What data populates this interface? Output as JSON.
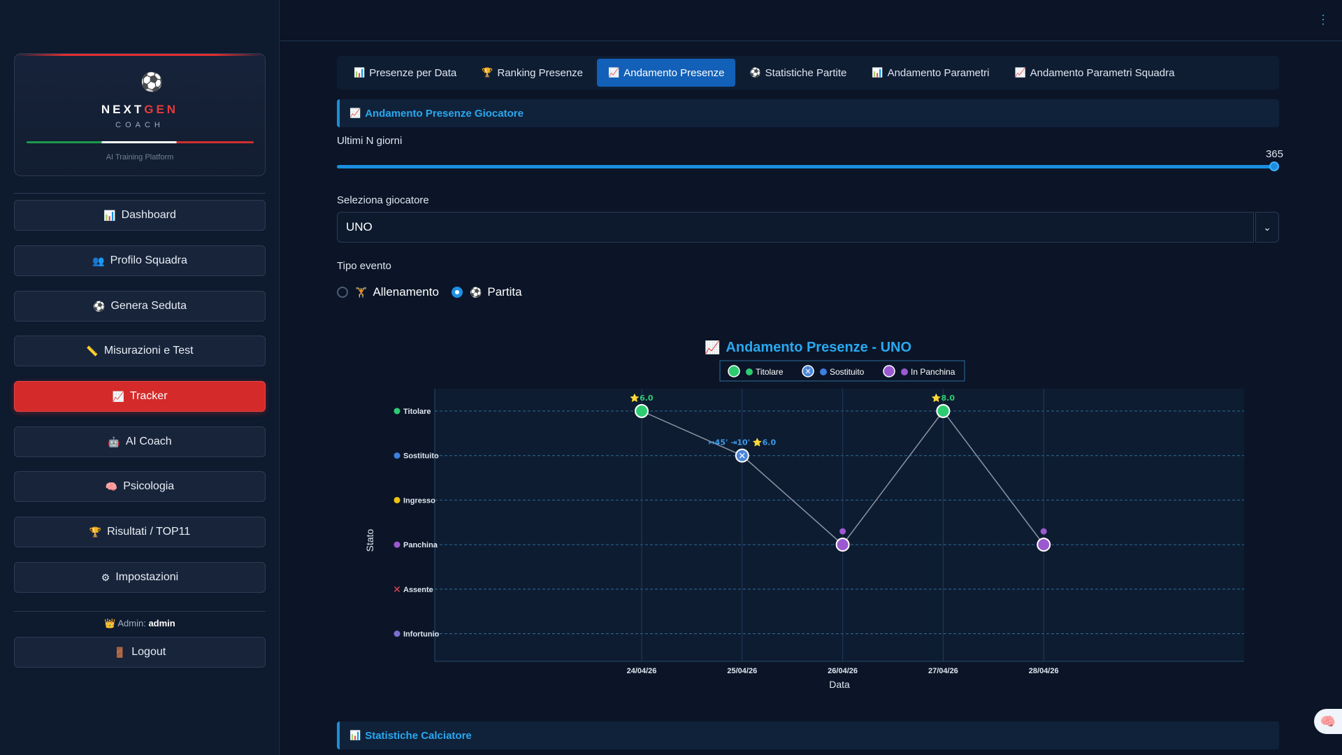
{
  "sidebar": {
    "logo": {
      "name_part1": "NEXT",
      "name_part2": "GEN",
      "subtitle": "COACH",
      "platform": "AI Training Platform"
    },
    "items": [
      {
        "label": "Dashboard",
        "icon": "bar-chart-icon",
        "glyph": "📊"
      },
      {
        "label": "Profilo Squadra",
        "icon": "team-icon",
        "glyph": "👥"
      },
      {
        "label": "Genera Seduta",
        "icon": "soccer-ball-icon",
        "glyph": "⚽"
      },
      {
        "label": "Misurazioni e Test",
        "icon": "ruler-icon",
        "glyph": "📏"
      },
      {
        "label": "Tracker",
        "icon": "trend-icon",
        "glyph": "📈",
        "active": true
      },
      {
        "label": "AI Coach",
        "icon": "robot-icon",
        "glyph": "🤖"
      },
      {
        "label": "Psicologia",
        "icon": "brain-icon",
        "glyph": "🧠"
      },
      {
        "label": "Risultati / TOP11",
        "icon": "trophy-icon",
        "glyph": "🏆"
      },
      {
        "label": "Impostazioni",
        "icon": "gear-icon",
        "glyph": "⚙"
      }
    ],
    "admin_prefix": "Admin:",
    "admin_user": "admin",
    "logout_label": "Logout"
  },
  "tabs": [
    {
      "label": "Presenze per Data",
      "icon": "bar-chart-icon",
      "glyph": "📊"
    },
    {
      "label": "Ranking Presenze",
      "icon": "trophy-icon",
      "glyph": "🏆"
    },
    {
      "label": "Andamento Presenze",
      "icon": "trend-icon",
      "glyph": "📈",
      "active": true
    },
    {
      "label": "Statistiche Partite",
      "icon": "soccer-ball-icon",
      "glyph": "⚽"
    },
    {
      "label": "Andamento Parametri",
      "icon": "bar-chart-icon",
      "glyph": "📊"
    },
    {
      "label": "Andamento Parametri Squadra",
      "icon": "trend-icon",
      "glyph": "📈"
    }
  ],
  "section": {
    "title": "Andamento Presenze Giocatore",
    "days_label": "Ultimi N giorni",
    "days_value": "365",
    "days_fraction": 1.0,
    "player_label": "Seleziona giocatore",
    "player_value": "UNO",
    "event_label": "Tipo evento",
    "event_options": [
      "Allenamento",
      "Partita"
    ],
    "event_selected": "Partita"
  },
  "stats_section": {
    "title": "Statistiche Calciatore"
  },
  "chart_data": {
    "type": "line",
    "title": "Andamento Presenze - UNO",
    "xlabel": "Data",
    "ylabel": "Stato",
    "categories": [
      "24/04/26",
      "25/04/26",
      "26/04/26",
      "27/04/26",
      "28/04/26"
    ],
    "y_levels": [
      "Titolare",
      "Sostituito",
      "Ingresso",
      "Panchina",
      "Assente",
      "Infortunio"
    ],
    "y_level_colors": [
      "#2ecc71",
      "#3d7fe0",
      "#f1c40f",
      "#9b59d0",
      "#e8455a",
      "#7a6fd0"
    ],
    "points": [
      {
        "x": "24/04/26",
        "y": "Titolare",
        "annotation": "⭐6.0"
      },
      {
        "x": "25/04/26",
        "y": "Sostituito",
        "annotation": "↦45' ⇥10' ⭐6.0"
      },
      {
        "x": "26/04/26",
        "y": "Panchina",
        "annotation": ""
      },
      {
        "x": "27/04/26",
        "y": "Titolare",
        "annotation": "⭐8.0"
      },
      {
        "x": "28/04/26",
        "y": "Panchina",
        "annotation": ""
      }
    ],
    "legend": [
      {
        "name": "Titolare",
        "color": "#2ecc71"
      },
      {
        "name": "Sostituito",
        "color": "#3d7fe0"
      },
      {
        "name": "In Panchina",
        "color": "#9b59d0"
      }
    ],
    "grid": true,
    "legend_position": "top-center"
  }
}
